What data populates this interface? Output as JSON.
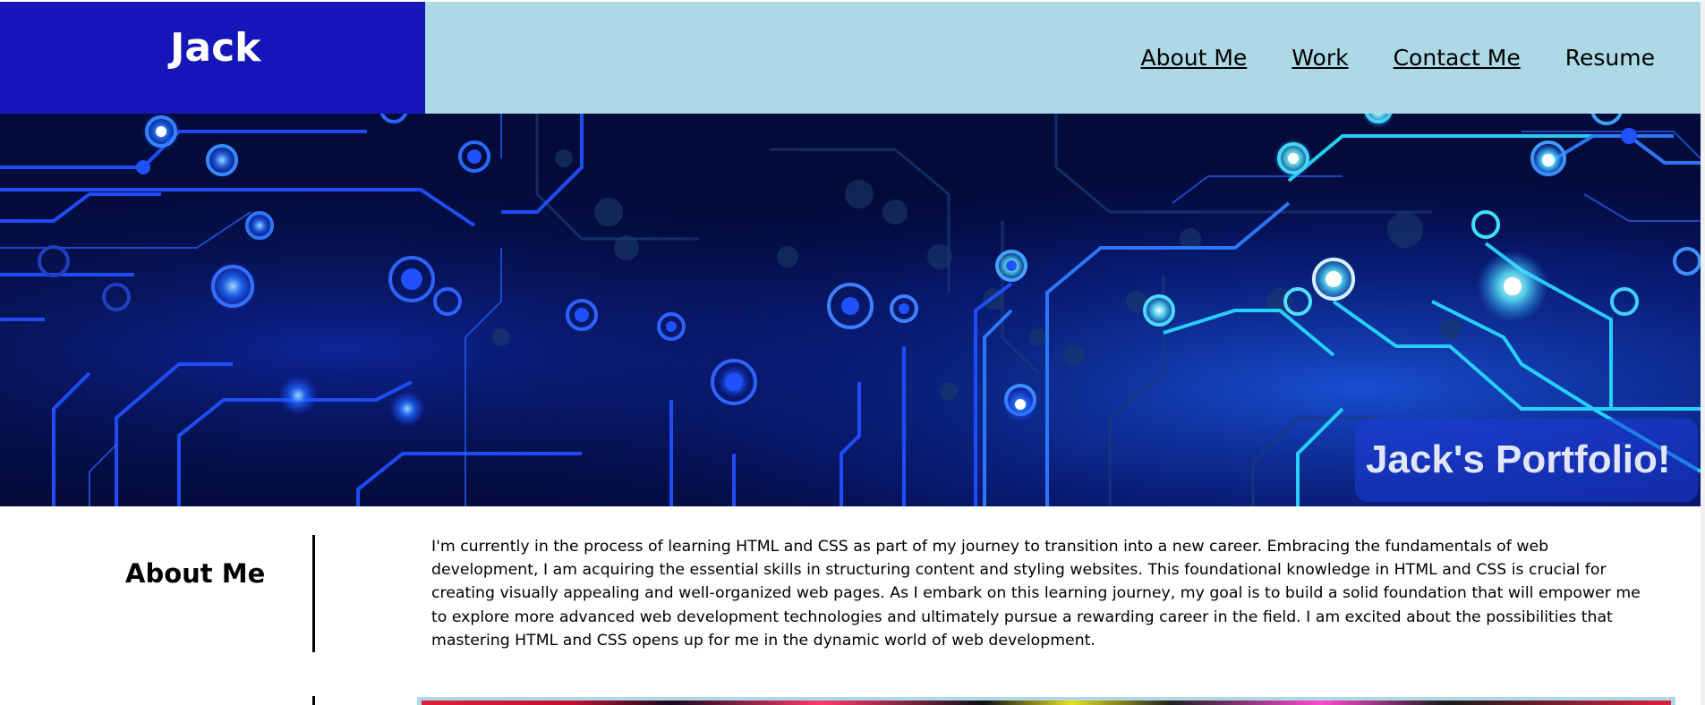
{
  "header": {
    "brand": "Jack",
    "nav": [
      {
        "label": "About Me",
        "underlined": true
      },
      {
        "label": "Work",
        "underlined": true
      },
      {
        "label": "Contact Me",
        "underlined": true
      },
      {
        "label": "Resume",
        "underlined": false
      }
    ]
  },
  "hero": {
    "title": "Jack's Portfolio!"
  },
  "about": {
    "heading": "About Me",
    "text": "I'm currently in the process of learning HTML and CSS as part of my journey to transition into a new career. Embracing the fundamentals of web development, I am acquiring the essential skills in structuring content and styling websites. This foundational knowledge in HTML and CSS is crucial for creating visually appealing and well-organized web pages. As I embark on this learning journey, my goal is to build a solid foundation that will empower me to explore more advanced web development technologies and ultimately pursue a rewarding career in the field. I am excited about the possibilities that mastering HTML and CSS opens up for me in the dynamic world of web development."
  },
  "colors": {
    "header_bg": "#add8e6",
    "brand_bg": "#1515b9",
    "hero_bg": "#030b3a"
  }
}
